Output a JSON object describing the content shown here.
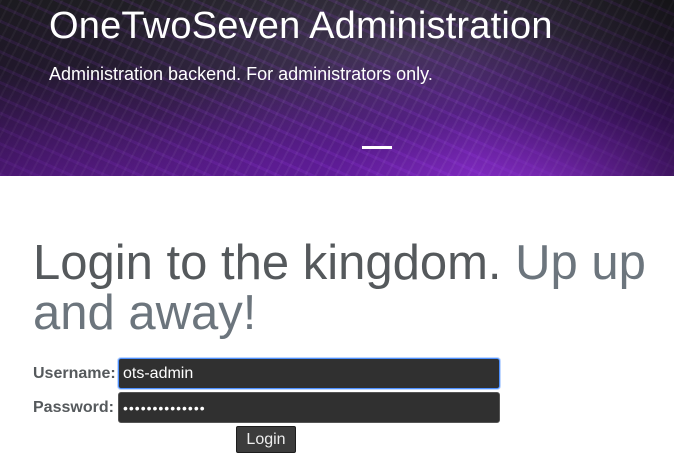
{
  "header": {
    "title": "OneTwoSeven Administration",
    "subtitle": "Administration backend. For administrators only.",
    "carousel": {
      "active_slide": 1
    }
  },
  "login": {
    "heading_main": "Login to the kingdom.",
    "heading_muted": "Up up and away!",
    "username_label": "Username:",
    "username_value": "ots-admin",
    "password_label": "Password:",
    "password_value": "••••••••••••••",
    "submit_label": "Login"
  },
  "colors": {
    "accent_purple": "#a037ff",
    "input_background": "#303030",
    "focus_ring": "#4d90fe",
    "heading_text": "#55595c",
    "heading_muted": "#6c757d"
  }
}
